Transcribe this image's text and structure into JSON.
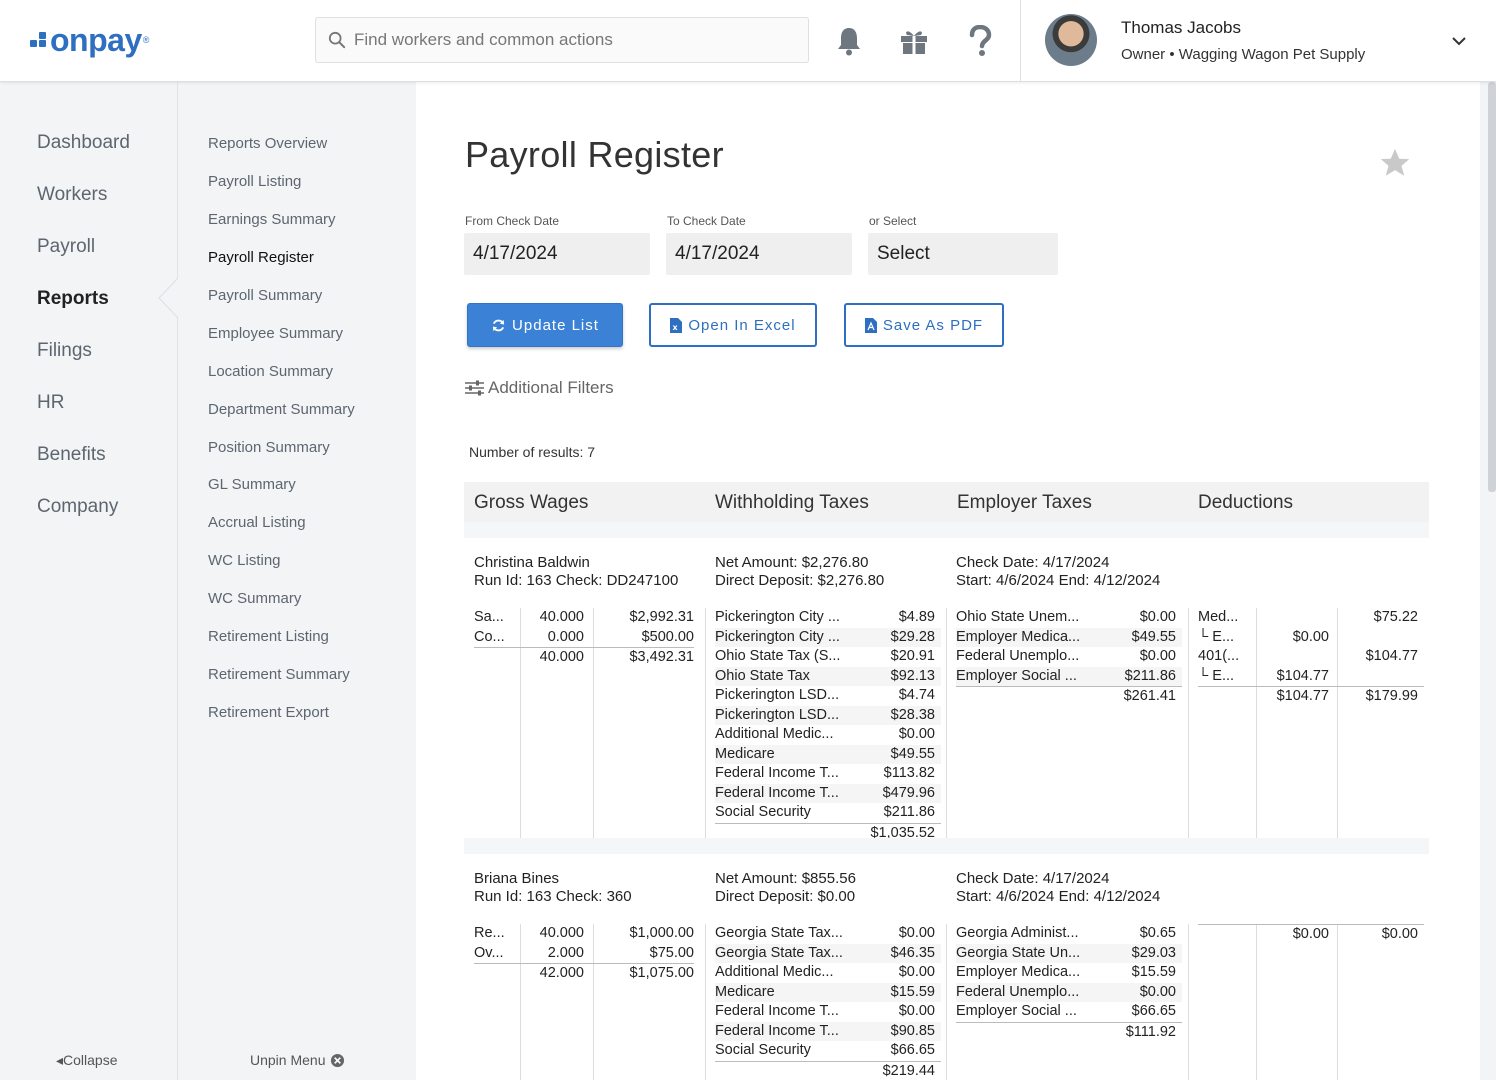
{
  "header": {
    "logo": "onpay",
    "search_placeholder": "Find workers and common actions",
    "user_name": "Thomas Jacobs",
    "user_role": "Owner • Wagging Wagon Pet Supply"
  },
  "primary_nav": {
    "items": [
      "Dashboard",
      "Workers",
      "Payroll",
      "Reports",
      "Filings",
      "HR",
      "Benefits",
      "Company"
    ],
    "active": "Reports",
    "collapse_label": "Collapse"
  },
  "secondary_nav": {
    "items": [
      "Reports Overview",
      "Payroll Listing",
      "Earnings Summary",
      "Payroll Register",
      "Payroll Summary",
      "Employee Summary",
      "Location Summary",
      "Department Summary",
      "Position Summary",
      "GL Summary",
      "Accrual Listing",
      "WC Listing",
      "WC Summary",
      "Retirement Listing",
      "Retirement Summary",
      "Retirement Export"
    ],
    "active": "Payroll Register",
    "unpin_label": "Unpin Menu"
  },
  "page": {
    "title": "Payroll Register",
    "from_label": "From Check Date",
    "from_value": "4/17/2024",
    "to_label": "To Check Date",
    "to_value": "4/17/2024",
    "select_label": "or Select",
    "select_value": "Select",
    "update_button": "Update List",
    "excel_button": "Open In Excel",
    "pdf_button": "Save As PDF",
    "filters_label": "Additional Filters",
    "results_count": "Number of results: 7"
  },
  "table": {
    "columns": [
      "Gross Wages",
      "Withholding Taxes",
      "Employer Taxes",
      "Deductions"
    ],
    "employees": [
      {
        "name": "Christina Baldwin",
        "run_line": "Run Id: 163 Check: DD247100",
        "net_line": "Net Amount: $2,276.80",
        "deposit_line": "Direct Deposit: $2,276.80",
        "check_date_line": "Check Date: 4/17/2024",
        "period_line": "Start: 4/6/2024   End: 4/12/2024",
        "gross": [
          {
            "type": "Sa...",
            "hours": "40.000",
            "amount": "$2,992.31"
          },
          {
            "type": "Co...",
            "hours": "0.000",
            "amount": "$500.00"
          }
        ],
        "gross_total_hours": "40.000",
        "gross_total_amount": "$3,492.31",
        "withholding": [
          {
            "name": "Pickerington City ...",
            "amount": "$4.89"
          },
          {
            "name": "Pickerington City ...",
            "amount": "$29.28"
          },
          {
            "name": "Ohio State Tax (S...",
            "amount": "$20.91"
          },
          {
            "name": "Ohio State Tax",
            "amount": "$92.13"
          },
          {
            "name": "Pickerington LSD...",
            "amount": "$4.74"
          },
          {
            "name": "Pickerington LSD...",
            "amount": "$28.38"
          },
          {
            "name": "Additional Medic...",
            "amount": "$0.00"
          },
          {
            "name": "Medicare",
            "amount": "$49.55"
          },
          {
            "name": "Federal Income T...",
            "amount": "$113.82"
          },
          {
            "name": "Federal Income T...",
            "amount": "$479.96"
          },
          {
            "name": "Social Security",
            "amount": "$211.86"
          }
        ],
        "withholding_total": "$1,035.52",
        "employer": [
          {
            "name": "Ohio State Unem...",
            "amount": "$0.00"
          },
          {
            "name": "Employer Medica...",
            "amount": "$49.55"
          },
          {
            "name": "Federal Unemplo...",
            "amount": "$0.00"
          },
          {
            "name": "Employer Social ...",
            "amount": "$211.86"
          }
        ],
        "employer_total": "$261.41",
        "deductions": [
          {
            "name": "Med...",
            "employer": "",
            "employee": "$75.22"
          },
          {
            "name": "└ E...",
            "employer": "$0.00",
            "employee": ""
          },
          {
            "name": "401(...",
            "employer": "",
            "employee": "$104.77"
          },
          {
            "name": "└ E...",
            "employer": "$104.77",
            "employee": ""
          }
        ],
        "deductions_total_employer": "$104.77",
        "deductions_total_employee": "$179.99"
      },
      {
        "name": "Briana Bines",
        "run_line": "Run Id: 163 Check: 360",
        "net_line": "Net Amount: $855.56",
        "deposit_line": "Direct Deposit: $0.00",
        "check_date_line": "Check Date: 4/17/2024",
        "period_line": "Start: 4/6/2024   End: 4/12/2024",
        "gross": [
          {
            "type": "Re...",
            "hours": "40.000",
            "amount": "$1,000.00"
          },
          {
            "type": "Ov...",
            "hours": "2.000",
            "amount": "$75.00"
          }
        ],
        "gross_total_hours": "42.000",
        "gross_total_amount": "$1,075.00",
        "withholding": [
          {
            "name": "Georgia State Tax...",
            "amount": "$0.00"
          },
          {
            "name": "Georgia State Tax...",
            "amount": "$46.35"
          },
          {
            "name": "Additional Medic...",
            "amount": "$0.00"
          },
          {
            "name": "Medicare",
            "amount": "$15.59"
          },
          {
            "name": "Federal Income T...",
            "amount": "$0.00"
          },
          {
            "name": "Federal Income T...",
            "amount": "$90.85"
          },
          {
            "name": "Social Security",
            "amount": "$66.65"
          }
        ],
        "withholding_total": "$219.44",
        "employer": [
          {
            "name": "Georgia Administ...",
            "amount": "$0.65"
          },
          {
            "name": "Georgia State Un...",
            "amount": "$29.03"
          },
          {
            "name": "Employer Medica...",
            "amount": "$15.59"
          },
          {
            "name": "Federal Unemplo...",
            "amount": "$0.00"
          },
          {
            "name": "Employer Social ...",
            "amount": "$66.65"
          }
        ],
        "employer_total": "$111.92",
        "deductions": [],
        "deductions_total_employer": "$0.00",
        "deductions_total_employee": "$0.00"
      }
    ]
  },
  "colors": {
    "brand": "#2f6fc1",
    "primary_button": "#3b82d6",
    "sidebar_bg": "#f3f4f6"
  }
}
